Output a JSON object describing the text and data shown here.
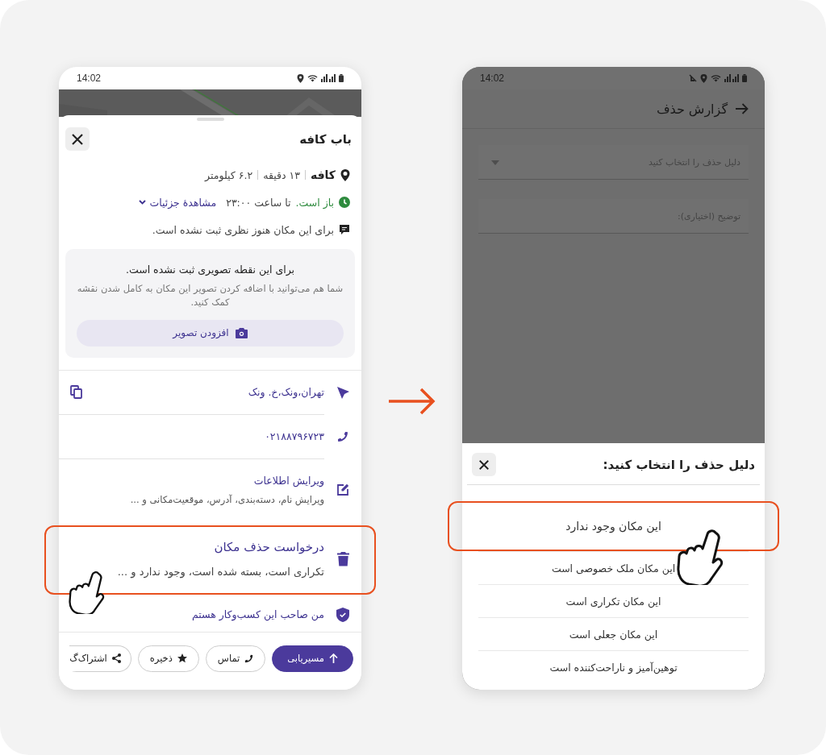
{
  "place_screen": {
    "status_bar": {
      "time": "14:02"
    },
    "title": "باب کافه",
    "info": {
      "category": "کافه",
      "duration": "۱۳ دقیقه",
      "distance": "۶.۲ کیلومتر",
      "open_status": "باز است.",
      "hours": "تا ساعت ۲۳:۰۰",
      "details_link": "مشاهدهٔ جزئیات",
      "reviews": "برای این مکان هنوز نظری ثبت نشده است."
    },
    "photo_card": {
      "title": "برای این نقطه تصویری ثبت نشده است.",
      "text": "شما هم می‌توانید با اضافه کردن تصویر این مکان به کامل شدن نقشه کمک کنید.",
      "button": "افزودن تصویر"
    },
    "rows": [
      {
        "kind": "address",
        "title": "تهران،ونک،خ. ونک",
        "highlighted": false
      },
      {
        "kind": "phone",
        "title": "۰۲۱۸۸۷۹۶۷۲۳",
        "highlighted": false
      },
      {
        "kind": "edit",
        "title": "ویرایش اطلاعات",
        "subtitle": "ویرایش نام، دسته‌بندی، آدرس، موقعیت‌مکانی و ...",
        "highlighted": false
      },
      {
        "kind": "delete",
        "title": "درخواست حذف مکان",
        "subtitle": "تکراری است، بسته شده است، وجود ندارد و ...",
        "highlighted": true
      },
      {
        "kind": "owner",
        "title": "من صاحب این کسب‌وکار هستم",
        "highlighted": false
      }
    ],
    "actions": [
      {
        "kind": "route",
        "label": "مسیریابی",
        "primary": true
      },
      {
        "kind": "call",
        "label": "تماس",
        "primary": false
      },
      {
        "kind": "save",
        "label": "ذخیره",
        "primary": false
      },
      {
        "kind": "share",
        "label": "اشتراک‌گ",
        "primary": false
      }
    ]
  },
  "report_screen": {
    "status_bar": {
      "time": "14:02"
    },
    "title": "گزارش حذف",
    "reason_field": {
      "placeholder": "دلیل حذف را انتخاب کنید"
    },
    "description_field": {
      "placeholder": "توضیح (اختیاری):"
    },
    "sheet": {
      "title": "دلیل حذف را انتخاب کنید:",
      "options": [
        {
          "label": "این مکان وجود ندارد",
          "highlighted": true
        },
        {
          "label": "این مکان ملک خصوصی است",
          "highlighted": false
        },
        {
          "label": "این مکان تکراری است",
          "highlighted": false
        },
        {
          "label": "این مکان جعلی است",
          "highlighted": false
        },
        {
          "label": "توهین‌آمیز و ناراحت‌کننده است",
          "highlighted": false
        }
      ]
    }
  }
}
